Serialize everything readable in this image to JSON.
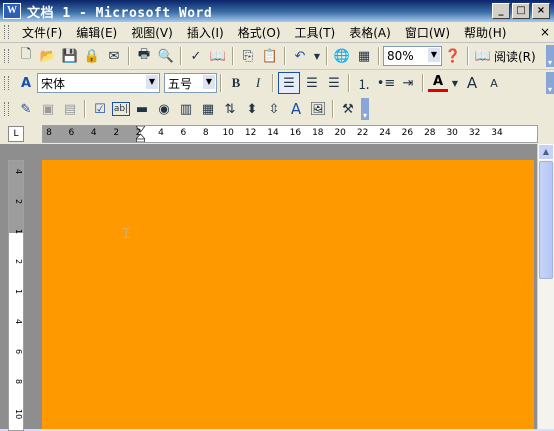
{
  "window": {
    "title": "文档 1 - Microsoft Word",
    "controls": {
      "minimize": "_",
      "restore": "□",
      "close": "×"
    }
  },
  "menu": {
    "items": [
      "文件(F)",
      "编辑(E)",
      "视图(V)",
      "插入(I)",
      "格式(O)",
      "工具(T)",
      "表格(A)",
      "窗口(W)",
      "帮助(H)"
    ],
    "close_doc": "×"
  },
  "standard_toolbar": {
    "zoom": "80%",
    "read_button": "阅读(R)"
  },
  "formatting_toolbar": {
    "style_icon": "A",
    "font": "宋体",
    "size": "五号",
    "bold": "B",
    "italic": "I",
    "font_color_label": "A",
    "grow_font": "A",
    "shrink_font": "A"
  },
  "forms_toolbar": {
    "text_label": "A",
    "textbox_label": "ab|"
  },
  "ruler": {
    "corner": "L",
    "ticks": [
      "8",
      "6",
      "4",
      "2",
      "2",
      "4",
      "6",
      "8",
      "10",
      "12",
      "14",
      "16",
      "18",
      "20",
      "22",
      "24",
      "26",
      "28",
      "30",
      "32",
      "34"
    ],
    "vticks": [
      "4",
      "2",
      "1",
      "2",
      "1",
      "4",
      "6",
      "8",
      "10"
    ]
  },
  "colors": {
    "page": "#ff9900",
    "workspace": "#8e8e8e",
    "titlebar": "#0a246a"
  }
}
